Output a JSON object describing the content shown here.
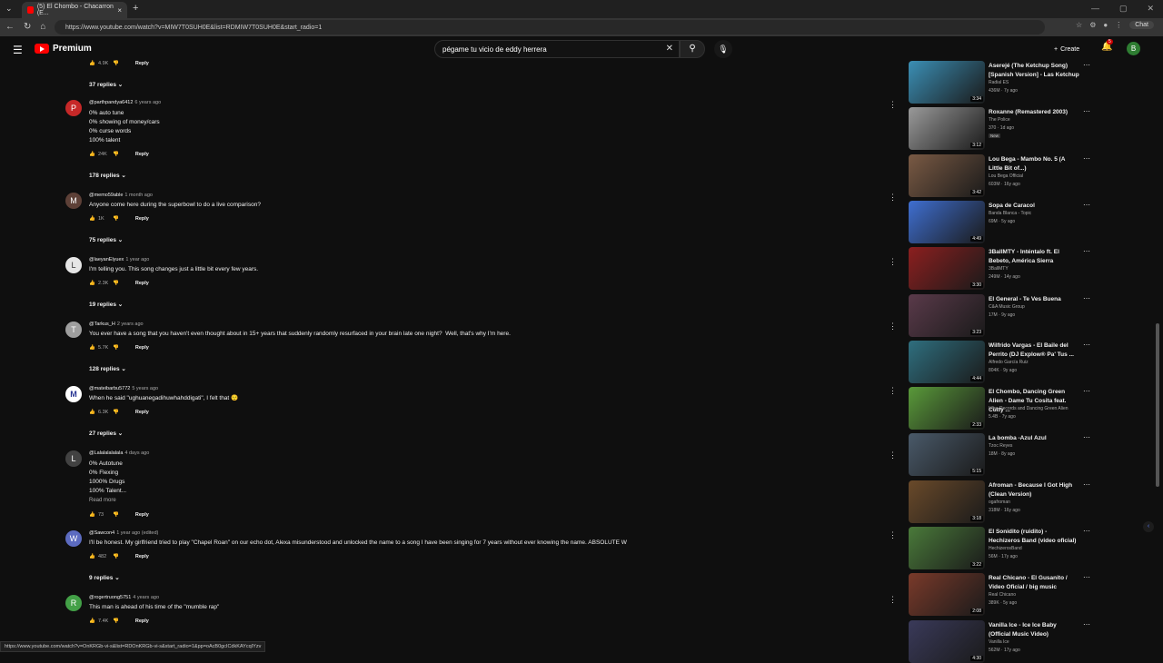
{
  "browser": {
    "tab_title": "(5) El Chombo - Chacarron (E...",
    "url": "https://www.youtube.com/watch?v=MIW7T0SUH0E&list=RDMIW7T0SUH0E&start_radio=1",
    "chat_label": "Chat"
  },
  "header": {
    "logo_text": "Premium",
    "search_value": "pégame tu vicio de eddy herrera",
    "create_label": "Create",
    "notif_count": "5",
    "avatar_letter": "B"
  },
  "top_fragment": {
    "count": "4.9K",
    "reply": "Reply"
  },
  "comments": [
    {
      "replies_label": "37 replies"
    },
    {
      "avatar": "P",
      "author": "@parthpandya6412",
      "ago": "6 years ago",
      "text": "0% auto tune\n0% showing of money/cars\n0% curse words\n100% talent",
      "likes": "24K",
      "reply": "Reply",
      "replies_label": "178 replies"
    },
    {
      "avatar": "M",
      "author": "@memo59able",
      "ago": "1 month ago",
      "text": "Anyone come here during the superbowl to do a live comparison?",
      "likes": "1K",
      "reply": "Reply",
      "replies_label": "75 replies"
    },
    {
      "avatar": "L",
      "author": "@laeyanElyuex",
      "ago": "1 year ago",
      "text": "I'm telling you. This song changes just a little bit every few years.",
      "likes": "2.3K",
      "reply": "Reply",
      "replies_label": "19 replies"
    },
    {
      "avatar": "T",
      "author": "@Tarkus_H",
      "ago": "2 years ago",
      "text": "You ever have a song that you haven't even thought about in 15+ years that suddenly randomly resurfaced in your brain late one night?  Well, that's why I'm here.",
      "likes": "5.7K",
      "reply": "Reply",
      "replies_label": "128 replies"
    },
    {
      "avatar": "M",
      "author": "@mateibarbu5772",
      "ago": "5 years ago",
      "text": "When he said \"ughuanegadihuwhahddigati\", I felt that 😌",
      "likes": "6.3K",
      "reply": "Reply",
      "replies_label": "27 replies"
    },
    {
      "avatar": "L",
      "author": "@Lalalalalalala",
      "ago": "4 days ago",
      "text": "0% Autotune\n0% Flexing\n1000% Drugs\n100% Talent...",
      "read_more": "Read more",
      "likes": "73",
      "reply": "Reply"
    },
    {
      "avatar": "W",
      "author": "@Sawcon4",
      "ago": "1 year ago (edited)",
      "text": "I'll be honest. My girlfriend tried to play \"Chapel Roan\" on our echo dot, Alexa misunderstood and unlocked the name to a song I have been singing for 7 years without ever knowing the name. ABSOLUTE W",
      "likes": "482",
      "reply": "Reply",
      "replies_label": "9 replies"
    },
    {
      "avatar": "R",
      "author": "@rogertruong5751",
      "ago": "4 years ago",
      "text": "This man is ahead of his time of the \"mumble rap\"",
      "likes": "7.4K",
      "reply": "Reply"
    }
  ],
  "videos": [
    {
      "title": "Aserejé (The Ketchup Song) [Spanish Version] - Las Ketchup",
      "channel": "Radial ES",
      "meta": "436M · 7y ago",
      "duration": "3:34",
      "color": "#3b8fb5"
    },
    {
      "title": "Roxanne (Remastered 2003)",
      "channel": "The Police",
      "meta": "370 · 1d ago",
      "badge": "New",
      "duration": "3:12",
      "color": "#9a9a9a"
    },
    {
      "title": "Lou Bega - Mambo No. 5 (A Little Bit of...)",
      "channel": "Lou Bega Official",
      "meta": "603M · 16y ago",
      "duration": "3:42",
      "color": "#7a5a44"
    },
    {
      "title": "Sopa de Caracol",
      "channel": "Banda Blanca - Topic",
      "meta": "69M · 5y ago",
      "duration": "4:49",
      "color": "#3f6fd1"
    },
    {
      "title": "3BallMTY - Inténtalo ft. El Bebeto, América Sierra",
      "channel": "3BallMTY",
      "meta": "249M · 14y ago",
      "duration": "3:30",
      "color": "#8c1f1f"
    },
    {
      "title": "El General - Te Ves Buena",
      "channel": "C&A Music Group",
      "meta": "17M · 9y ago",
      "duration": "3:23",
      "color": "#5a3a4a"
    },
    {
      "title": "Wilfrido Vargas - El Baile del Perrito (DJ Explow® Pa' Tus ...",
      "channel": "Alfredo García Ruiz",
      "meta": "804K · 9y ago",
      "duration": "4:44",
      "color": "#2f6f7f"
    },
    {
      "title": "El Chombo, Dancing Green Alien - Dame Tu Cosita feat. Cutty ...",
      "channel": "Ultra Records and Dancing Green Alien",
      "meta": "5.4B · 7y ago",
      "duration": "2:33",
      "color": "#5a9a3a"
    },
    {
      "title": "La bomba -Azul Azul",
      "channel": "Tzoc Reyes",
      "meta": "18M · 8y ago",
      "duration": "5:15",
      "color": "#4a5a6a"
    },
    {
      "title": "Afroman - Because I Got High (Clean Version)",
      "channel": "ogafroman",
      "meta": "318M · 16y ago",
      "duration": "3:18",
      "color": "#6a4a2a"
    },
    {
      "title": "El Sonidito (ruidito) - Hechizeros Band (video oficial)",
      "channel": "HechizerosBand",
      "meta": "56M · 17y ago",
      "duration": "3:22",
      "color": "#4a7a3a"
    },
    {
      "title": "Real Chicano - El Gusanito / Video Oficial / big music",
      "channel": "Real Chicano",
      "meta": "389K · 5y ago",
      "duration": "2:08",
      "color": "#7a3a2a"
    },
    {
      "title": "Vanilla Ice - Ice Ice Baby (Official Music Video)",
      "channel": "Vanilla Ice",
      "meta": "562M · 17y ago",
      "duration": "4:30",
      "color": "#3a3a5a"
    }
  ],
  "status_url": "https://www.youtube.com/watch?v=OnKRGb-vi-s&list=RDOnKRGb-vi-s&start_radio=1&pp=oAcB0gcICdkKAYcqIYzv"
}
